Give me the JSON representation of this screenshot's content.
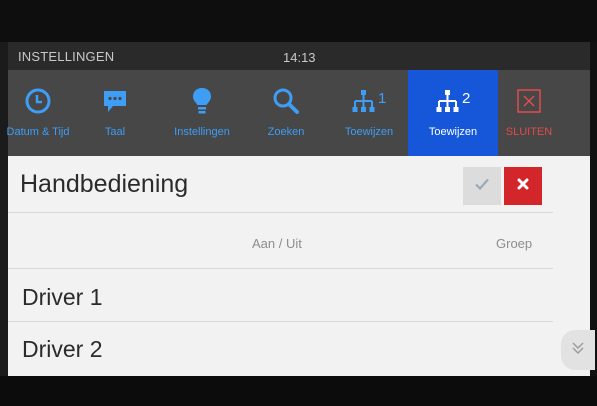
{
  "statusbar": {
    "title": "INSTELLINGEN",
    "time": "14:13"
  },
  "toolbar": {
    "items": [
      {
        "label": "Datum & Tijd",
        "icon": "clock-icon"
      },
      {
        "label": "Taal",
        "icon": "speech-bubble-icon"
      },
      {
        "label": "Instellingen",
        "icon": "lightbulb-icon"
      },
      {
        "label": "Zoeken",
        "icon": "search-icon"
      },
      {
        "label": "Toewijzen",
        "icon": "network-1-icon",
        "badge": "1"
      },
      {
        "label": "Toewijzen",
        "icon": "network-2-icon",
        "badge": "2",
        "active": true
      },
      {
        "label": "SLUITEN",
        "icon": "close-icon"
      }
    ]
  },
  "page": {
    "title": "Handbediening"
  },
  "table": {
    "columns": [
      "Aan / Uit",
      "Groep"
    ],
    "rows": [
      {
        "label": "Driver 1"
      },
      {
        "label": "Driver 2"
      }
    ]
  },
  "colors": {
    "accent": "#1557d8",
    "icon_blue": "#3e9df5",
    "danger": "#d3262a",
    "toolbar_bg": "#474747"
  }
}
